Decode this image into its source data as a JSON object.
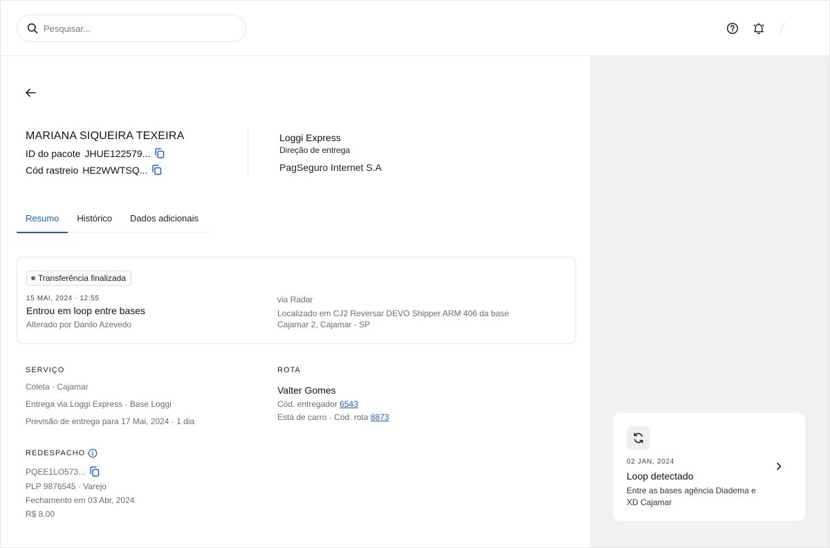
{
  "search": {
    "placeholder": "Pesquisar..."
  },
  "header": {
    "customer_name": "MARIANA SIQUEIRA TEXEIRA",
    "package_id_label": "ID do pacote",
    "package_id_value": "JHUE122579...",
    "tracking_label": "Cód rastreio",
    "tracking_value": "HE2WWTSQ...",
    "carrier": "Loggi Express",
    "direction_label": "Direção de entrega",
    "company": "PagSeguro Internet S.A"
  },
  "tabs": [
    {
      "label": "Resumo",
      "active": true
    },
    {
      "label": "Histórico",
      "active": false
    },
    {
      "label": "Dados adicionais",
      "active": false
    }
  ],
  "status": {
    "badge": "Transferência finalizada",
    "date": "15 MAI, 2024 · 12:55",
    "title": "Entrou em loop entre bases",
    "author": "Alterado por Danilo Azevedo",
    "via": "via Radar",
    "location": "Localizado em CJ2 Reversar DEVO Shipper ARM 406 da base Cajamar 2, Cajamar - SP"
  },
  "service": {
    "title": "SERVIÇO",
    "lines": [
      "Coleta · Cajamar",
      "Entrega via Loggi Express · Base Loggi",
      "Previsão de entrega para 17 Mai, 2024 · 1 dia"
    ]
  },
  "route": {
    "title": "ROTA",
    "driver": "Valter Gomes",
    "courier_code_label": "Cód. entregador",
    "courier_code": "6543",
    "vehicle_label": "Está de carro · Cód. rota",
    "route_code": "8873"
  },
  "redispatch": {
    "title": "REDESPACHO",
    "code": "PQEE1LO573...",
    "lines": [
      "PLP 9876545 · Varejo",
      "Fechamento em 03 Abr, 2024",
      "R$ 8,00"
    ]
  },
  "loop_card": {
    "date": "02 JAN, 2024",
    "title": "Loop detectado",
    "description": "Entre as bases agência Diadema e XD Cajamar"
  },
  "colors": {
    "accent": "#1a5fd1",
    "panel_bg": "#f1f1f1",
    "muted_text": "#6c6c6c"
  },
  "icons": [
    "search-icon",
    "help-icon",
    "bell-icon",
    "back-arrow-icon",
    "copy-icon",
    "info-icon",
    "loop-icon",
    "chevron-right-icon"
  ]
}
